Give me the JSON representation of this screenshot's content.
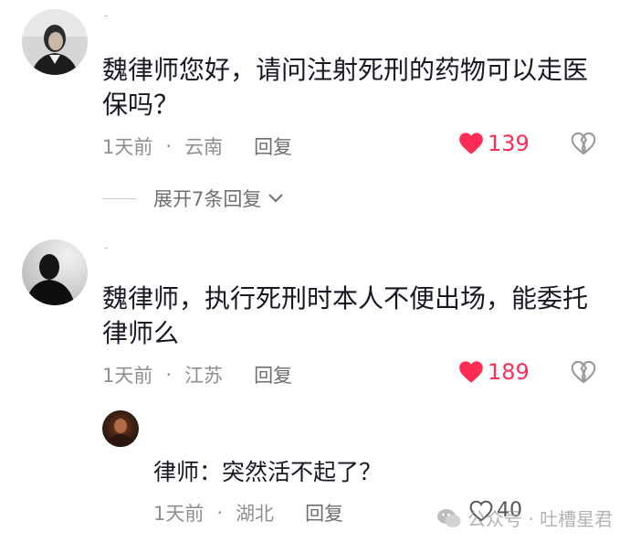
{
  "comments": [
    {
      "username": "-",
      "text": "魏律师您好，请问注射死刑的药物可以走医保吗？",
      "time": "1天前",
      "location": "云南",
      "reply_label": "回复",
      "likes": "139",
      "expand_label": "展开7条回复"
    },
    {
      "username": "-",
      "text": "魏律师，执行死刑时本人不便出场，能委托律师么",
      "time": "1天前",
      "location": "江苏",
      "reply_label": "回复",
      "likes": "189",
      "reply": {
        "text": "律师：突然活不起了？",
        "time": "1天前",
        "location": "湖北",
        "reply_label": "回复",
        "likes": "40"
      }
    }
  ],
  "separator": "·",
  "watermark": "公众号 · 吐槽星君",
  "colors": {
    "like_active": "#ff2c55",
    "meta": "#8f8f8f",
    "text": "#161823"
  }
}
